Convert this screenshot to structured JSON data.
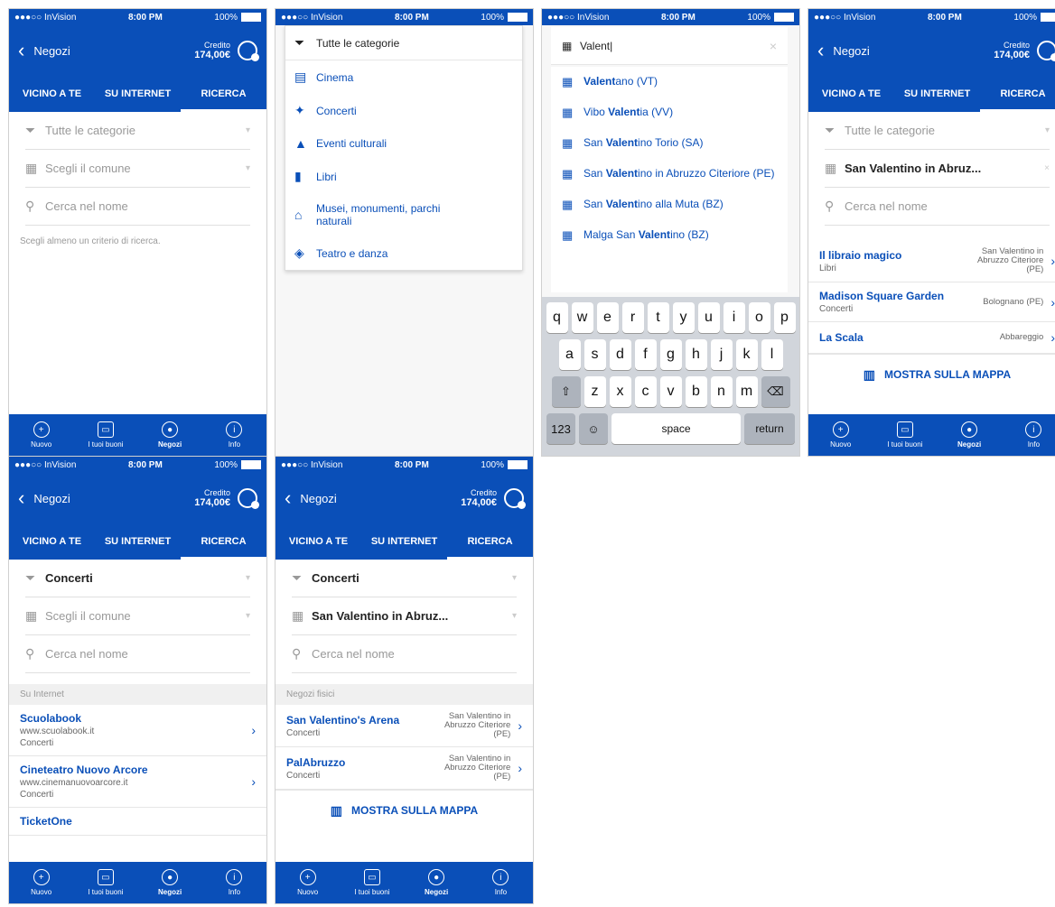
{
  "status": {
    "carrier": "●●●○○ InVision",
    "time": "8:00 PM",
    "battery": "100%"
  },
  "header": {
    "title": "Negozi",
    "credit_label": "Credito",
    "credit_value": "174,00€"
  },
  "tabs": [
    "VICINO A TE",
    "SU INTERNET",
    "RICERCA"
  ],
  "form": {
    "categories_placeholder": "Tutte le categorie",
    "comune_placeholder": "Scegli il comune",
    "name_placeholder": "Cerca nel nome"
  },
  "hint": "Scegli almeno un criterio di ricerca.",
  "bottom_nav": [
    "Nuovo",
    "I tuoi buoni",
    "Negozi",
    "Info"
  ],
  "dropdown": {
    "items": [
      "Tutte le categorie",
      "Cinema",
      "Concerti",
      "Eventi culturali",
      "Libri",
      "Musei, monumenti, parchi naturali",
      "Teatro e danza"
    ]
  },
  "search": {
    "query": "Valent",
    "suggestions": [
      {
        "pre": "",
        "bold": "Valent",
        "post": "ano (VT)"
      },
      {
        "pre": "Vibo ",
        "bold": "Valent",
        "post": "ia (VV)"
      },
      {
        "pre": "San ",
        "bold": "Valent",
        "post": "ino Torio (SA)"
      },
      {
        "pre": "San ",
        "bold": "Valent",
        "post": "ino in Abruzzo Citeriore (PE)"
      },
      {
        "pre": "San ",
        "bold": "Valent",
        "post": "ino alla Muta (BZ)"
      },
      {
        "pre": "Malga San ",
        "bold": "Valent",
        "post": "ino (BZ)"
      }
    ],
    "keys_row1": [
      "q",
      "w",
      "e",
      "r",
      "t",
      "y",
      "u",
      "i",
      "o",
      "p"
    ],
    "keys_row2": [
      "a",
      "s",
      "d",
      "f",
      "g",
      "h",
      "j",
      "k",
      "l"
    ],
    "keys_row3": [
      "z",
      "x",
      "c",
      "v",
      "b",
      "n",
      "m"
    ],
    "key_123": "123",
    "key_space": "space",
    "key_return": "return"
  },
  "screen4": {
    "comune": "San Valentino in Abruz...",
    "results": [
      {
        "name": "Il libraio magico",
        "cat": "Libri",
        "loc": "San Valentino in Abruzzo Citeriore (PE)"
      },
      {
        "name": "Madison Square Garden",
        "cat": "Concerti",
        "loc": "Bolognano (PE)"
      },
      {
        "name": "La Scala",
        "cat": "",
        "loc": "Abbareggio"
      }
    ],
    "map_label": "MOSTRA SULLA MAPPA"
  },
  "screen5": {
    "category": "Concerti",
    "section": "Su Internet",
    "results": [
      {
        "name": "Scuolabook",
        "url": "www.scuolabook.it",
        "cat": "Concerti"
      },
      {
        "name": "Cineteatro Nuovo Arcore",
        "url": "www.cinemanuovoarcore.it",
        "cat": "Concerti"
      },
      {
        "name": "TicketOne",
        "url": "",
        "cat": ""
      }
    ]
  },
  "screen6": {
    "category": "Concerti",
    "comune": "San Valentino in Abruz...",
    "section": "Negozi fisici",
    "results": [
      {
        "name": "San Valentino's Arena",
        "cat": "Concerti",
        "loc": "San Valentino in Abruzzo Citeriore (PE)"
      },
      {
        "name": "PalAbruzzo",
        "cat": "Concerti",
        "loc": "San Valentino in Abruzzo Citeriore (PE)"
      }
    ],
    "map_label": "MOSTRA SULLA MAPPA"
  }
}
